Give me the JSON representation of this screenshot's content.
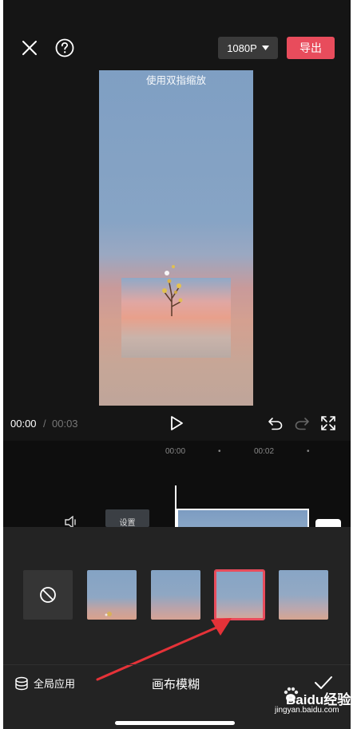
{
  "header": {
    "close_icon": "close-icon",
    "help_icon": "help-icon",
    "resolution": "1080P",
    "export_label": "导出"
  },
  "preview": {
    "hint": "使用双指缩放"
  },
  "playback": {
    "current_time": "00:00",
    "separator": "/",
    "total_time": "00:03"
  },
  "timeline": {
    "ticks": [
      "00:00",
      "00:02"
    ],
    "clip_button_label": "设置"
  },
  "blur_panel": {
    "options": [
      "none",
      "blur-1",
      "blur-2",
      "blur-3",
      "blur-4"
    ],
    "selected_index": 3
  },
  "footer": {
    "apply_all_label": "全局应用",
    "title": "画布模糊"
  },
  "watermark": {
    "brand": "Baidu经验",
    "url": "jingyan.baidu.com"
  },
  "colors": {
    "accent": "#e84c5c",
    "panel_bg": "#232323",
    "arrow": "#e53238"
  }
}
